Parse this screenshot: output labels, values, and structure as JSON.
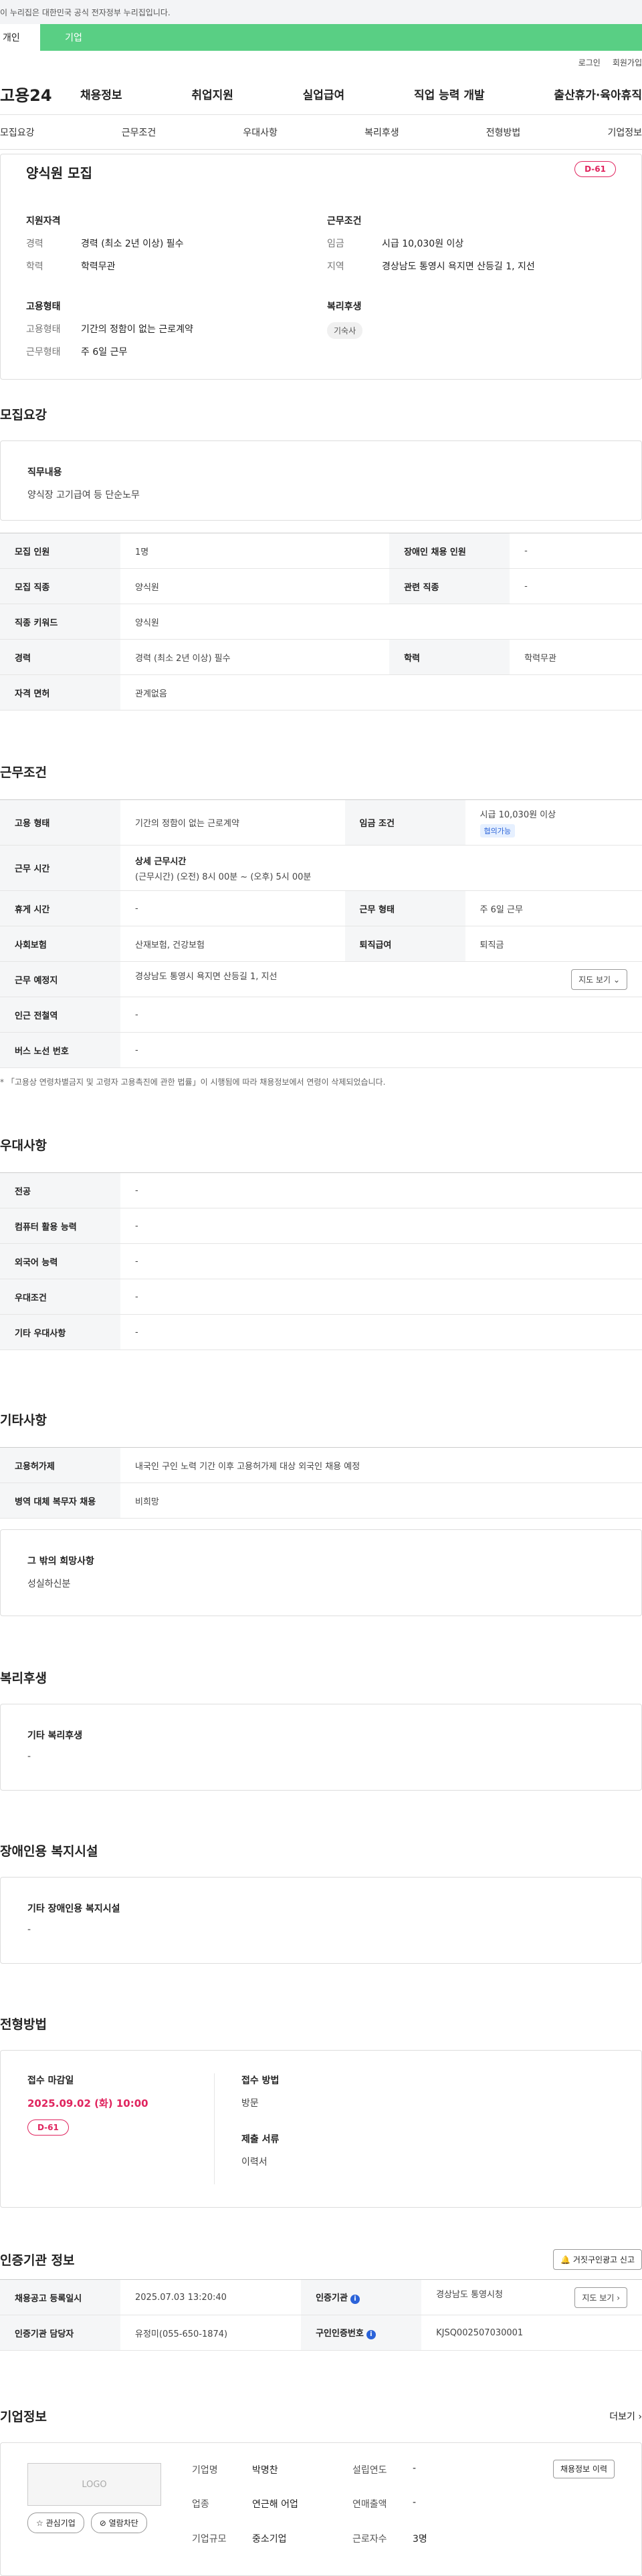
{
  "gov_banner": "이 누리집은 대한민국 공식 전자정부 누리집입니다.",
  "user_tabs": [
    "개인",
    "기업"
  ],
  "util": [
    "로그인",
    "회원가입"
  ],
  "logo": "고용24",
  "gnb": [
    "채용정보",
    "취업지원",
    "실업급여",
    "직업 능력 개발",
    "출산휴가·육아휴직"
  ],
  "subnav": [
    "모집요강",
    "근무조건",
    "우대사항",
    "복리후생",
    "전형방법",
    "기업정보"
  ],
  "summary": {
    "title": "양식원 모집",
    "dday": "D-61",
    "qual_h": "지원자격",
    "exp_k": "경력",
    "exp_v": "경력 (최소 2년 이상) 필수",
    "edu_k": "학력",
    "edu_v": "학력무관",
    "work_h": "근무조건",
    "wage_k": "임금",
    "wage_v": "시급 10,030원 이상",
    "area_k": "지역",
    "area_v": "경상남도 통영시 욕지면 산등길 1, 지선",
    "emp_h": "고용형태",
    "emp_type_k": "고용형태",
    "emp_type_v": "기간의 정함이 없는 근로계약",
    "work_type_k": "근무형태",
    "work_type_v": "주 6일 근무",
    "welfare_h": "복리후생",
    "welfare_tag": "기숙사"
  },
  "recruit": {
    "title": "모집요강",
    "job_h": "직무내용",
    "job_v": "양식장 고기급여 등 단순노무",
    "rows": [
      [
        "모집 인원",
        "1명",
        "장애인 채용 인원",
        "-"
      ],
      [
        "모집 직종",
        "양식원",
        "관련 직종",
        "-"
      ],
      [
        "직종 키워드",
        "양식원"
      ],
      [
        "경력",
        "경력 (최소 2년 이상) 필수",
        "학력",
        "학력무관"
      ],
      [
        "자격 면허",
        "관계없음"
      ]
    ]
  },
  "cond": {
    "title": "근무조건",
    "emp_k": "고용 형태",
    "emp_v": "기간의 정함이 없는 근로계약",
    "wage_k": "임금 조건",
    "wage_v": "시급 10,030원 이상",
    "wage_badge": "협의가능",
    "time_k": "근무 시간",
    "time_h": "상세 근무시간",
    "time_v": "(근무시간) (오전) 8시 00분 ~ (오후) 5시 00분",
    "rest_k": "휴게 시간",
    "rest_v": "-",
    "wtype_k": "근무 형태",
    "wtype_v": "주 6일 근무",
    "ins_k": "사회보험",
    "ins_v": "산재보험, 건강보험",
    "sev_k": "퇴직급여",
    "sev_v": "퇴직금",
    "place_k": "근무 예정지",
    "place_v": "경상남도 통영시 욕지면 산등길 1, 지선",
    "map_btn": "지도 보기",
    "subway_k": "인근 전철역",
    "subway_v": "-",
    "bus_k": "버스 노선 번호",
    "bus_v": "-",
    "note": "* 「고용상 연령차별금지 및 고령자 고용촉진에 관한 법률」이 시행됨에 따라 채용정보에서 연령이 삭제되었습니다."
  },
  "pref": {
    "title": "우대사항",
    "rows": [
      [
        "전공",
        "-"
      ],
      [
        "컴퓨터 활용 능력",
        "-"
      ],
      [
        "외국어 능력",
        "-"
      ],
      [
        "우대조건",
        "-"
      ],
      [
        "기타 우대사항",
        "-"
      ]
    ]
  },
  "etc": {
    "title": "기타사항",
    "rows": [
      [
        "고용허가제",
        "내국인 구인 노력 기간 이후 고용허가제 대상 외국인 채용 예정"
      ],
      [
        "병역 대체 복무자 채용",
        "비희망"
      ]
    ],
    "other_h": "그 밖의 희망사항",
    "other_v": "성실하신분"
  },
  "welfare": {
    "title": "복리후생",
    "h": "기타 복리후생",
    "v": "-"
  },
  "disabled": {
    "title": "장애인용 복지시설",
    "h": "기타 장애인용 복지시설",
    "v": "-"
  },
  "process": {
    "title": "전형방법",
    "deadline_h": "접수 마감일",
    "deadline_v": "2025.09.02 (화) 10:00",
    "dday": "D-61",
    "method_h": "접수 방법",
    "method_v": "방문",
    "docs_h": "제출 서류",
    "docs_v": "이력서"
  },
  "agency": {
    "title": "인증기관 정보",
    "report_btn": "거짓구인광고 신고",
    "reg_k": "채용공고 등록일시",
    "reg_v": "2025.07.03 13:20:40",
    "org_k": "인증기관",
    "org_v": "경상남도 통영시청",
    "map_btn": "지도 보기",
    "mgr_k": "인증기관 담당자",
    "mgr_v": "유정미(055-650-1874)",
    "num_k": "구인인증번호",
    "num_v": "KJSQ002507030001"
  },
  "company": {
    "title": "기업정보",
    "more": "더보기",
    "logo": "LOGO",
    "fav_btn": "관심기업",
    "block_btn": "열람차단",
    "history_btn": "채용정보 이력",
    "name_k": "기업명",
    "name_v": "박명찬",
    "ind_k": "업종",
    "ind_v": "연근해 어업",
    "size_k": "기업규모",
    "size_v": "중소기업",
    "year_k": "설립연도",
    "year_v": "-",
    "sales_k": "연매출액",
    "sales_v": "-",
    "emp_k": "근로자수",
    "emp_v": "3명"
  }
}
